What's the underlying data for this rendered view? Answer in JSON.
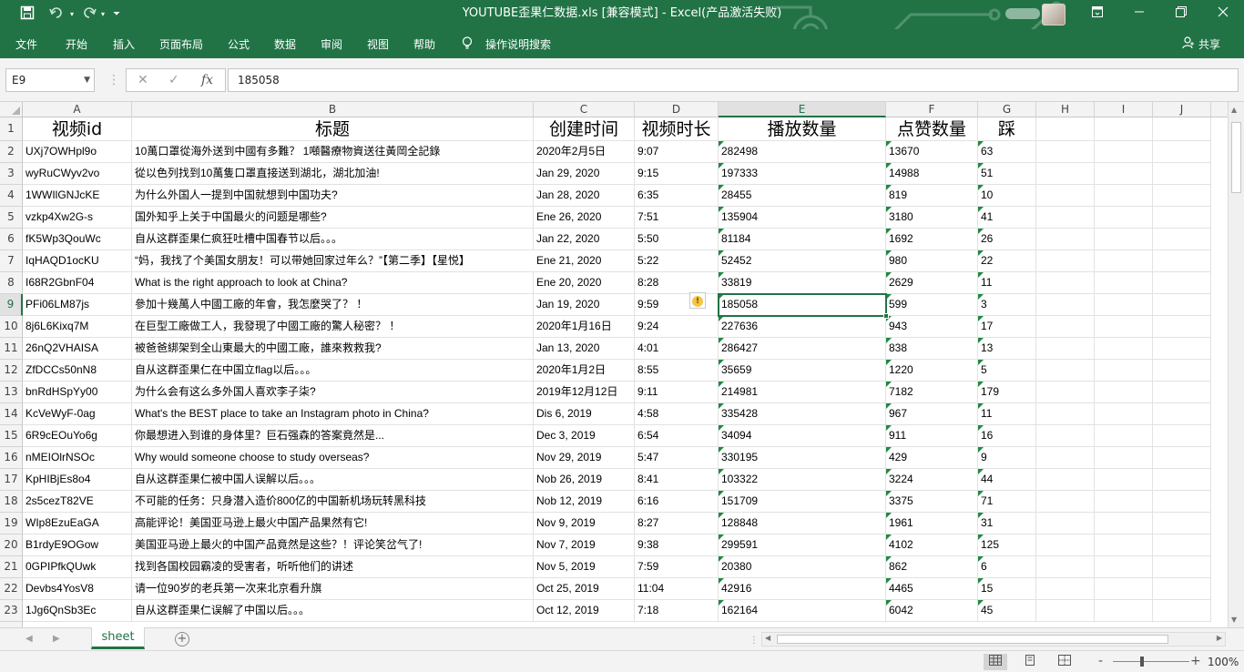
{
  "window": {
    "title": "YOUTUBE歪果仁数据.xls  [兼容模式]  -  Excel(产品激活失败)",
    "quick_access": {
      "save_icon": "save-icon",
      "undo_icon": "undo-icon",
      "redo_icon": "redo-icon",
      "customize_icon": "customize-icon"
    },
    "controls": {
      "ribbon_options_icon": "ribbon-display-icon",
      "minimize_icon": "minimize-icon",
      "restore_icon": "restore-icon",
      "close_icon": "close-icon"
    }
  },
  "ribbon": {
    "tabs": [
      "文件",
      "开始",
      "插入",
      "页面布局",
      "公式",
      "数据",
      "审阅",
      "视图",
      "帮助"
    ],
    "tell_me": "操作说明搜索",
    "share": "共享"
  },
  "formula_bar": {
    "name_box": "E9",
    "formula": "185058",
    "fx_label": "fx"
  },
  "sheet": {
    "columns": [
      "A",
      "B",
      "C",
      "D",
      "E",
      "F",
      "G",
      "H",
      "I",
      "J"
    ],
    "selected_column": "E",
    "selected_row": 9,
    "header_row": [
      "视频id",
      "标题",
      "创建时间",
      "视频时长",
      "播放数量",
      "点赞数量",
      "踩"
    ],
    "rows": [
      {
        "num": "2",
        "cells": [
          "UXj7OWHpl9o",
          "10萬口罩從海外送到中國有多難？ 1噸醫療物資送往黃岡全記錄",
          "2020年2月5日",
          "9:07",
          "282498",
          "13670",
          "63"
        ]
      },
      {
        "num": "3",
        "cells": [
          "wyRuCWyv2vo",
          "從以色列找到10萬隻口罩直接送到湖北，湖北加油!",
          "Jan 29, 2020",
          "9:15",
          "197333",
          "14988",
          "51"
        ]
      },
      {
        "num": "4",
        "cells": [
          "1WWIlGNJcKE",
          "为什么外国人一提到中国就想到中国功夫?",
          "Jan 28, 2020",
          "6:35",
          "28455",
          "819",
          "10"
        ]
      },
      {
        "num": "5",
        "cells": [
          "vzkp4Xw2G-s",
          "国外知乎上关于中国最火的问题是哪些?",
          "Ene 26, 2020",
          "7:51",
          "135904",
          "3180",
          "41"
        ]
      },
      {
        "num": "6",
        "cells": [
          "fK5Wp3QouWc",
          "自从这群歪果仁疯狂吐槽中国春节以后。。。",
          "Jan 22, 2020",
          "5:50",
          "81184",
          "1692",
          "26"
        ]
      },
      {
        "num": "7",
        "cells": [
          "IqHAQD1ocKU",
          "“妈，我找了个美国女朋友！可以带她回家过年么？”【第二季】【星悦】",
          "Ene 21, 2020",
          "5:22",
          "52452",
          "980",
          "22"
        ]
      },
      {
        "num": "8",
        "cells": [
          "I68R2GbnF04",
          "What is the right approach to look at China?",
          "Ene 20, 2020",
          "8:28",
          "33819",
          "2629",
          "11"
        ]
      },
      {
        "num": "9",
        "cells": [
          "PFi06LM87js",
          "參加十幾萬人中國工廠的年會，我怎麼哭了？ ！",
          "Jan 19, 2020",
          "9:59",
          "185058",
          "599",
          "3"
        ]
      },
      {
        "num": "10",
        "cells": [
          "8j6L6Kixq7M",
          "在巨型工廠做工人，我發現了中國工廠的驚人秘密？ ！",
          "2020年1月16日",
          "9:24",
          "227636",
          "943",
          "17"
        ]
      },
      {
        "num": "11",
        "cells": [
          "26nQ2VHAISA",
          "被爸爸綁架到全山東最大的中國工廠，誰來救救我?",
          "Jan 13, 2020",
          "4:01",
          "286427",
          "838",
          "13"
        ]
      },
      {
        "num": "12",
        "cells": [
          "ZfDCCs50nN8",
          "自从这群歪果仁在中国立flag以后。。。",
          "2020年1月2日",
          "8:55",
          "35659",
          "1220",
          "5"
        ]
      },
      {
        "num": "13",
        "cells": [
          "bnRdHSpYy00",
          "为什么会有这么多外国人喜欢李子柒?",
          "2019年12月12日",
          "9:11",
          "214981",
          "7182",
          "179"
        ]
      },
      {
        "num": "14",
        "cells": [
          "KcVeWyF-0ag",
          "What's the BEST place to take an Instagram photo in China?",
          "Dis 6, 2019",
          "4:58",
          "335428",
          "967",
          "11"
        ]
      },
      {
        "num": "15",
        "cells": [
          "6R9cEOuYo6g",
          "你最想进入到谁的身体里？巨石强森的答案竟然是...",
          "Dec 3, 2019",
          "6:54",
          "34094",
          "911",
          "16"
        ]
      },
      {
        "num": "16",
        "cells": [
          "nMEIOlrNSOc",
          "Why would someone choose to study overseas?",
          "Nov 29, 2019",
          "5:47",
          "330195",
          "429",
          "9"
        ]
      },
      {
        "num": "17",
        "cells": [
          "KpHIBjEs8o4",
          "自从这群歪果仁被中国人误解以后。。。",
          "Nob 26, 2019",
          "8:41",
          "103322",
          "3224",
          "44"
        ]
      },
      {
        "num": "18",
        "cells": [
          "2s5cezT82VE",
          "不可能的任务：只身潜入造价800亿的中国新机场玩转黑科技",
          "Nob 12, 2019",
          "6:16",
          "151709",
          "3375",
          "71"
        ]
      },
      {
        "num": "19",
        "cells": [
          "WIp8EzuEaGA",
          "高能评论！美国亚马逊上最火中国产品果然有它!",
          "Nov 9, 2019",
          "8:27",
          "128848",
          "1961",
          "31"
        ]
      },
      {
        "num": "20",
        "cells": [
          "B1rdyE9OGow",
          "美国亚马逊上最火的中国产品竟然是这些？！评论笑岔气了!",
          "Nov 7, 2019",
          "9:38",
          "299591",
          "4102",
          "125"
        ]
      },
      {
        "num": "21",
        "cells": [
          "0GPIPfkQUwk",
          "找到各国校园霸凌的受害者，听听他们的讲述",
          "Nov 5, 2019",
          "7:59",
          "20380",
          "862",
          "6"
        ]
      },
      {
        "num": "22",
        "cells": [
          "Devbs4YosV8",
          "请一位90岁的老兵第一次来北京看升旗",
          "Oct 25, 2019",
          "11:04",
          "42916",
          "4465",
          "15"
        ]
      },
      {
        "num": "23",
        "cells": [
          "1Jg6QnSb3Ec",
          "自从这群歪果仁误解了中国以后。。。",
          "Oct 12, 2019",
          "7:18",
          "162164",
          "6042",
          "45"
        ]
      }
    ]
  },
  "tabs": {
    "sheet_name": "sheet",
    "add_icon": "add-sheet-icon"
  },
  "status": {
    "zoom": "100%",
    "zoom_minus": "-",
    "zoom_plus": "+"
  },
  "colors": {
    "accent": "#217346",
    "warn_triangle": "#1e8a3e"
  }
}
